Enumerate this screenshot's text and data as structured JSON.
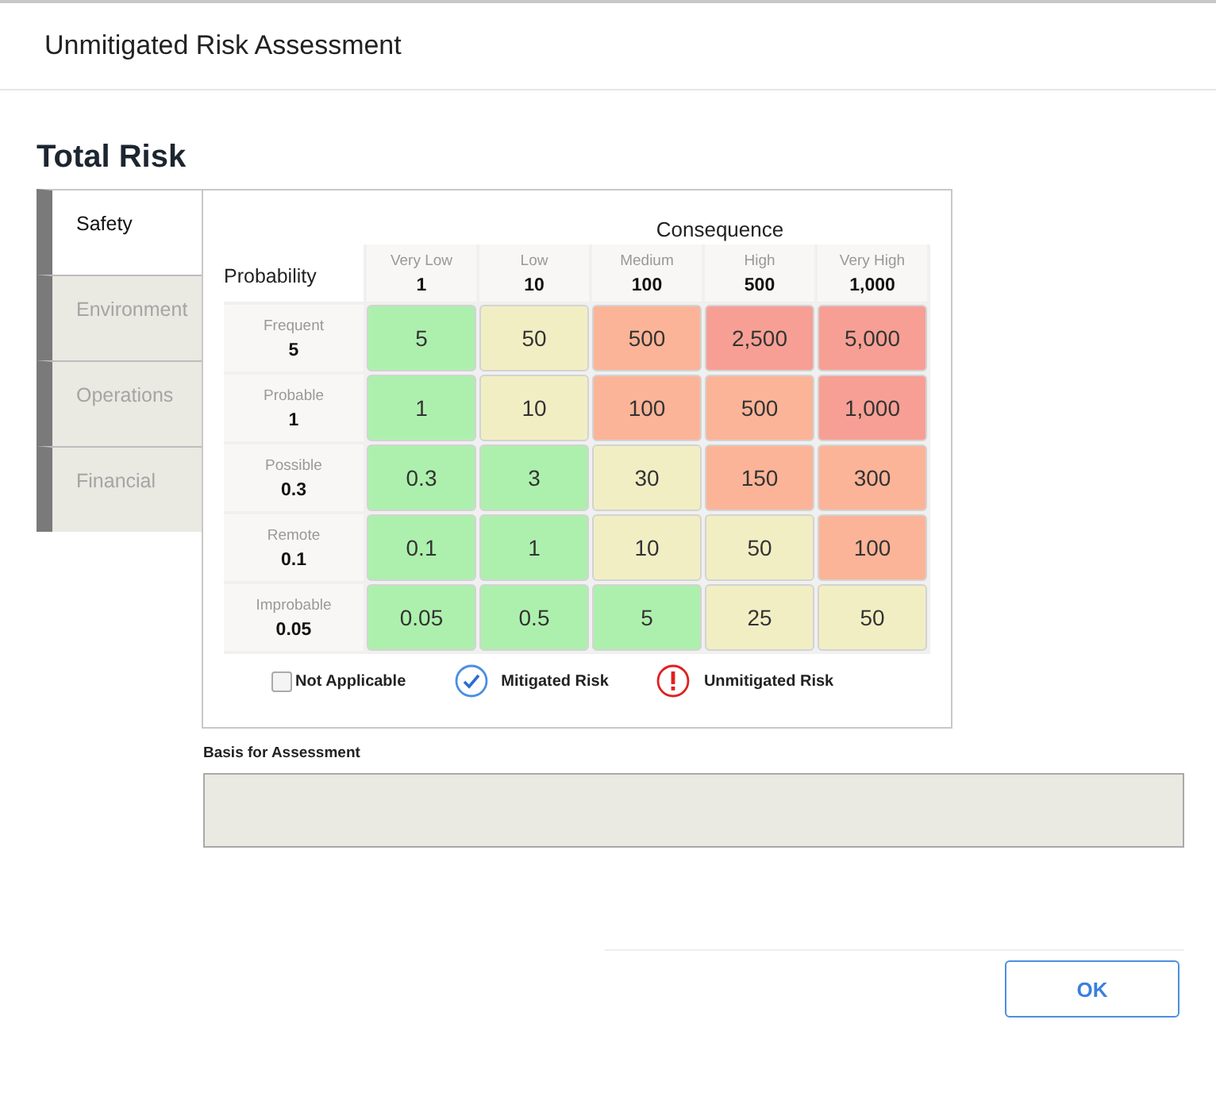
{
  "window": {
    "title": "Unmitigated Risk Assessment"
  },
  "heading": "Total Risk",
  "tabs": [
    {
      "label": "Safety",
      "selected": true
    },
    {
      "label": "Environment",
      "selected": false
    },
    {
      "label": "Operations",
      "selected": false
    },
    {
      "label": "Financial",
      "selected": false
    }
  ],
  "matrix": {
    "consequence_label": "Consequence",
    "probability_label": "Probability",
    "columns": [
      {
        "name": "Very Low",
        "value": "1"
      },
      {
        "name": "Low",
        "value": "10"
      },
      {
        "name": "Medium",
        "value": "100"
      },
      {
        "name": "High",
        "value": "500"
      },
      {
        "name": "Very High",
        "value": "1,000"
      }
    ],
    "rows": [
      {
        "name": "Frequent",
        "value": "5",
        "cells": [
          {
            "value": "5",
            "color": "#adf0ad"
          },
          {
            "value": "50",
            "color": "#f2eec4"
          },
          {
            "value": "500",
            "color": "#fbb497"
          },
          {
            "value": "2,500",
            "color": "#f79f94"
          },
          {
            "value": "5,000",
            "color": "#f79f94"
          }
        ]
      },
      {
        "name": "Probable",
        "value": "1",
        "cells": [
          {
            "value": "1",
            "color": "#adf0ad"
          },
          {
            "value": "10",
            "color": "#f2eec4"
          },
          {
            "value": "100",
            "color": "#fbb497"
          },
          {
            "value": "500",
            "color": "#fbb497"
          },
          {
            "value": "1,000",
            "color": "#f79f94"
          }
        ]
      },
      {
        "name": "Possible",
        "value": "0.3",
        "cells": [
          {
            "value": "0.3",
            "color": "#adf0ad"
          },
          {
            "value": "3",
            "color": "#adf0ad"
          },
          {
            "value": "30",
            "color": "#f2eec4"
          },
          {
            "value": "150",
            "color": "#fbb497"
          },
          {
            "value": "300",
            "color": "#fbb497"
          }
        ]
      },
      {
        "name": "Remote",
        "value": "0.1",
        "cells": [
          {
            "value": "0.1",
            "color": "#adf0ad"
          },
          {
            "value": "1",
            "color": "#adf0ad"
          },
          {
            "value": "10",
            "color": "#f2eec4"
          },
          {
            "value": "50",
            "color": "#f2eec4"
          },
          {
            "value": "100",
            "color": "#fbb497"
          }
        ]
      },
      {
        "name": "Improbable",
        "value": "0.05",
        "cells": [
          {
            "value": "0.05",
            "color": "#adf0ad"
          },
          {
            "value": "0.5",
            "color": "#adf0ad"
          },
          {
            "value": "5",
            "color": "#adf0ad"
          },
          {
            "value": "25",
            "color": "#f2eec4"
          },
          {
            "value": "50",
            "color": "#f2eec4"
          }
        ]
      }
    ]
  },
  "legend": {
    "not_applicable": {
      "label": "Not Applicable",
      "checked": false
    },
    "mitigated": "Mitigated Risk",
    "unmitigated": "Unmitigated Risk"
  },
  "basis": {
    "label": "Basis for Assessment"
  },
  "buttons": [
    "OK"
  ]
}
